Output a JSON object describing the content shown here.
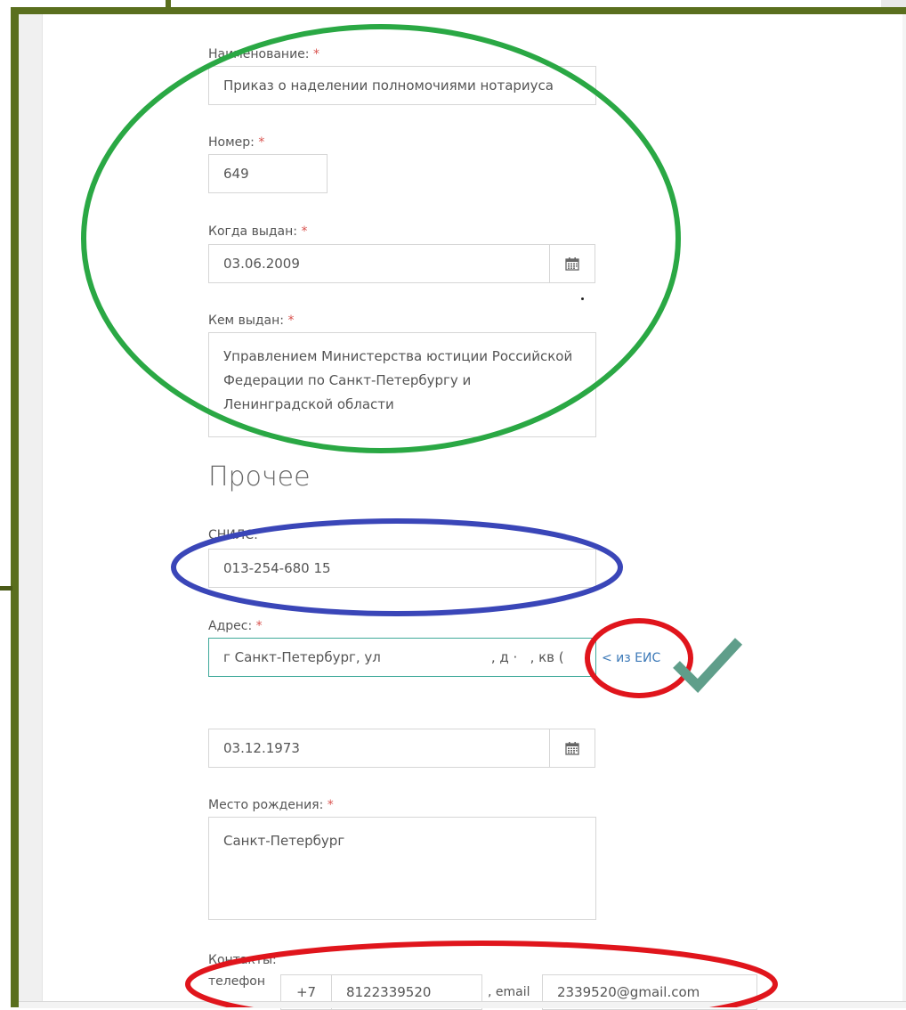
{
  "form": {
    "name_label": "Наименование:",
    "name_value": "Приказ о наделении полномочиями нотариуса",
    "number_label": "Номер:",
    "number_value": "649",
    "issued_date_label": "Когда выдан:",
    "issued_date_value": "03.06.2009",
    "issued_by_label": "Кем выдан:",
    "issued_by_value": "Управлением Министерства юстиции Российской Федерации по Санкт-Петербургу и Ленинградской области",
    "required_mark": "*"
  },
  "other": {
    "section_title": "Прочее",
    "snils_label": "СНИЛС:",
    "snils_value": "013-254-680 15",
    "address_label": "Адрес:",
    "address_value": "г Санкт-Петербург, ул                          , д ·   , кв (",
    "from_eis_link": "< из ЕИС",
    "birth_date_value": "03.12.1973",
    "birthplace_label": "Место рождения:",
    "birthplace_value": "Санкт-Петербург",
    "contacts_label": "Контакты:",
    "phone_label": "телефон",
    "phone_prefix": "+7",
    "phone_value": "8122339520",
    "email_label": ", email",
    "email_value": "2339520@gmail.com"
  },
  "icons": {
    "calendar": "calendar-icon",
    "checkmark": "checkmark-icon"
  },
  "colors": {
    "frame": "#5a6f1e",
    "green_annotation": "#2aa844",
    "blue_annotation": "#3a46b8",
    "red_annotation": "#e0151c",
    "checkmark": "#5f9e8a",
    "required": "#d9534f",
    "link": "#3d7ab8"
  }
}
